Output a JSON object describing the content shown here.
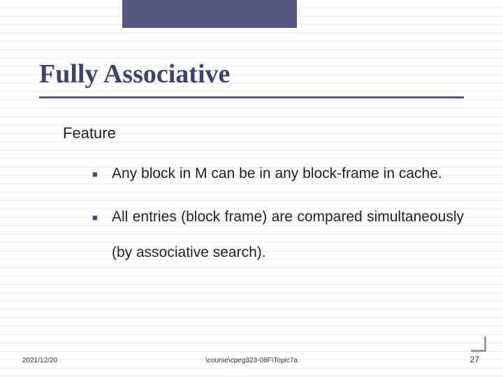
{
  "slide": {
    "title": "Fully Associative",
    "subheading": "Feature",
    "bullets": [
      "Any block in M can be in any block-frame in cache.",
      "All entries (block frame) are compared simultaneously (by associative search)."
    ]
  },
  "footer": {
    "date": "2021/12/20",
    "path": "\\course\\cpeg323-08F\\Topic7a",
    "page_number": "27"
  }
}
